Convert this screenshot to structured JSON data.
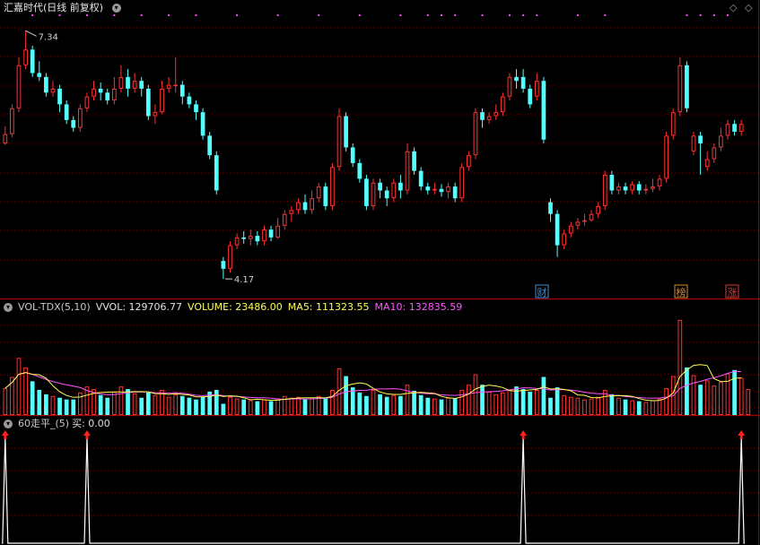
{
  "main": {
    "stock_name": "汇嘉时代",
    "period": "(日线 前复权)",
    "high_label": "7.34",
    "low_label": "4.17",
    "markers": [
      {
        "id": "cai",
        "text": "财",
        "color": "#3a8fd8"
      },
      {
        "id": "bang",
        "text": "榜",
        "color": "#d08a3a"
      },
      {
        "id": "zhang",
        "text": "涨",
        "color": "#d83a3a"
      }
    ]
  },
  "volume": {
    "indicator": "VOL-TDX(5,10)",
    "vvol": "VVOL: 129706.77",
    "volume": "VOLUME: 23486.00",
    "ma5": "MA5: 111323.55",
    "ma10": "MA10: 132835.59"
  },
  "signal": {
    "indicator": "60走平_(5)",
    "buy": "买: 0.00"
  },
  "colors": {
    "up": "#ff3232",
    "down": "#54ffff",
    "ma5": "#ffff55",
    "ma10": "#ff55ff",
    "grid": "#7a0000",
    "separator": "#a00000",
    "signal": "#ffffff",
    "arrow": "#ff2020"
  },
  "chart_data": [
    {
      "type": "candlestick",
      "title": "汇嘉时代 (日线 前复权)",
      "annotations": [
        {
          "label": "7.34",
          "value": 7.34
        },
        {
          "label": "4.17",
          "value": 4.17
        }
      ],
      "candles": [
        [
          5.9,
          6.02,
          6.12,
          5.88
        ],
        [
          6.02,
          6.35,
          6.4,
          5.98
        ],
        [
          6.35,
          6.9,
          7.0,
          6.3
        ],
        [
          6.9,
          7.1,
          7.34,
          6.85
        ],
        [
          7.1,
          6.8,
          7.15,
          6.75
        ],
        [
          6.8,
          6.75,
          6.95,
          6.7
        ],
        [
          6.75,
          6.55,
          6.8,
          6.5
        ],
        [
          6.55,
          6.6,
          6.7,
          6.5
        ],
        [
          6.6,
          6.4,
          6.65,
          6.3
        ],
        [
          6.4,
          6.2,
          6.45,
          6.15
        ],
        [
          6.2,
          6.1,
          6.25,
          6.05
        ],
        [
          6.1,
          6.35,
          6.4,
          6.05
        ],
        [
          6.35,
          6.5,
          6.55,
          6.3
        ],
        [
          6.5,
          6.6,
          6.7,
          6.45
        ],
        [
          6.6,
          6.55,
          6.68,
          6.45
        ],
        [
          6.55,
          6.45,
          6.6,
          6.4
        ],
        [
          6.45,
          6.6,
          6.75,
          6.4
        ],
        [
          6.6,
          6.75,
          6.9,
          6.55
        ],
        [
          6.75,
          6.6,
          6.85,
          6.5
        ],
        [
          6.6,
          6.7,
          6.8,
          6.55
        ],
        [
          6.7,
          6.6,
          6.75,
          6.5
        ],
        [
          6.6,
          6.25,
          6.65,
          6.2
        ],
        [
          6.25,
          6.3,
          6.4,
          6.15
        ],
        [
          6.3,
          6.6,
          6.7,
          6.28
        ],
        [
          6.6,
          6.65,
          6.75,
          6.55
        ],
        [
          6.65,
          6.65,
          7.0,
          6.55
        ],
        [
          6.65,
          6.5,
          6.7,
          6.4
        ],
        [
          6.5,
          6.4,
          6.55,
          6.35
        ],
        [
          6.4,
          6.3,
          6.45,
          6.2
        ],
        [
          6.3,
          6.0,
          6.35,
          5.95
        ],
        [
          6.0,
          5.75,
          6.05,
          5.7
        ],
        [
          5.75,
          5.3,
          5.8,
          5.25
        ],
        [
          4.4,
          4.3,
          4.45,
          4.17
        ],
        [
          4.3,
          4.6,
          4.65,
          4.25
        ],
        [
          4.6,
          4.7,
          4.75,
          4.55
        ],
        [
          4.7,
          4.68,
          4.78,
          4.62
        ],
        [
          4.68,
          4.72,
          4.8,
          4.6
        ],
        [
          4.72,
          4.65,
          4.78,
          4.6
        ],
        [
          4.65,
          4.8,
          4.85,
          4.6
        ],
        [
          4.8,
          4.7,
          4.85,
          4.65
        ],
        [
          4.7,
          4.85,
          4.95,
          4.68
        ],
        [
          4.85,
          5.0,
          5.05,
          4.8
        ],
        [
          5.0,
          5.05,
          5.1,
          4.9
        ],
        [
          5.05,
          5.15,
          5.2,
          5.0
        ],
        [
          5.15,
          5.05,
          5.25,
          5.0
        ],
        [
          5.05,
          5.2,
          5.3,
          5.0
        ],
        [
          5.2,
          5.35,
          5.4,
          5.15
        ],
        [
          5.35,
          5.1,
          5.4,
          5.05
        ],
        [
          5.1,
          5.6,
          5.65,
          5.05
        ],
        [
          5.6,
          6.25,
          6.35,
          5.55
        ],
        [
          6.25,
          5.85,
          6.3,
          5.8
        ],
        [
          5.85,
          5.65,
          5.9,
          5.6
        ],
        [
          5.65,
          5.45,
          5.7,
          5.4
        ],
        [
          5.45,
          5.1,
          5.5,
          5.05
        ],
        [
          5.1,
          5.4,
          5.45,
          5.05
        ],
        [
          5.4,
          5.3,
          5.45,
          5.2
        ],
        [
          5.3,
          5.2,
          5.35,
          5.1
        ],
        [
          5.2,
          5.4,
          5.45,
          5.15
        ],
        [
          5.4,
          5.3,
          5.5,
          5.2
        ],
        [
          5.3,
          5.8,
          5.9,
          5.25
        ],
        [
          5.8,
          5.55,
          5.85,
          5.5
        ],
        [
          5.55,
          5.35,
          5.6,
          5.3
        ],
        [
          5.35,
          5.3,
          5.4,
          5.25
        ],
        [
          5.3,
          5.32,
          5.4,
          5.25
        ],
        [
          5.32,
          5.28,
          5.38,
          5.22
        ],
        [
          5.28,
          5.35,
          5.4,
          5.2
        ],
        [
          5.35,
          5.2,
          5.4,
          5.15
        ],
        [
          5.2,
          5.6,
          5.65,
          5.15
        ],
        [
          5.6,
          5.75,
          5.8,
          5.55
        ],
        [
          5.75,
          6.3,
          6.35,
          5.7
        ],
        [
          6.3,
          6.2,
          6.35,
          6.1
        ],
        [
          6.2,
          6.25,
          6.3,
          6.15
        ],
        [
          6.25,
          6.3,
          6.4,
          6.2
        ],
        [
          6.3,
          6.5,
          6.55,
          6.25
        ],
        [
          6.5,
          6.75,
          6.8,
          6.45
        ],
        [
          6.75,
          6.7,
          6.85,
          6.6
        ],
        [
          6.75,
          6.6,
          6.85,
          6.55
        ],
        [
          6.6,
          6.4,
          6.65,
          6.35
        ],
        [
          6.5,
          6.7,
          6.8,
          6.45
        ],
        [
          6.7,
          5.95,
          6.75,
          5.9
        ],
        [
          5.15,
          5.0,
          5.2,
          4.9
        ],
        [
          5.0,
          4.6,
          5.05,
          4.45
        ],
        [
          4.6,
          4.75,
          4.8,
          4.55
        ],
        [
          4.75,
          4.85,
          4.9,
          4.7
        ],
        [
          4.85,
          4.9,
          4.95,
          4.8
        ],
        [
          4.9,
          4.92,
          5.0,
          4.85
        ],
        [
          4.92,
          5.0,
          5.05,
          4.9
        ],
        [
          5.0,
          5.1,
          5.15,
          4.95
        ],
        [
          5.1,
          5.5,
          5.55,
          5.05
        ],
        [
          5.5,
          5.3,
          5.55,
          5.25
        ],
        [
          5.3,
          5.35,
          5.4,
          5.25
        ],
        [
          5.35,
          5.3,
          5.4,
          5.25
        ],
        [
          5.3,
          5.38,
          5.42,
          5.25
        ],
        [
          5.38,
          5.3,
          5.42,
          5.25
        ],
        [
          5.3,
          5.32,
          5.38,
          5.25
        ],
        [
          5.32,
          5.35,
          5.45,
          5.28
        ],
        [
          5.35,
          5.45,
          5.5,
          5.3
        ],
        [
          5.45,
          6.0,
          6.05,
          5.4
        ],
        [
          6.0,
          6.3,
          6.35,
          5.95
        ],
        [
          6.3,
          6.9,
          7.0,
          6.25
        ],
        [
          6.9,
          6.35,
          6.95,
          6.3
        ],
        [
          5.8,
          6.0,
          6.05,
          5.75
        ],
        [
          6.0,
          5.9,
          6.05,
          5.5
        ],
        [
          5.6,
          5.7,
          5.8,
          5.55
        ],
        [
          5.7,
          5.85,
          5.9,
          5.65
        ],
        [
          5.85,
          6.0,
          6.1,
          5.8
        ],
        [
          6.0,
          6.15,
          6.2,
          5.95
        ],
        [
          6.15,
          6.05,
          6.2,
          6.0
        ],
        [
          6.05,
          6.15,
          6.2,
          6.0
        ]
      ]
    },
    {
      "type": "bar",
      "title": "VOL-TDX(5,10)",
      "legend": [
        "VVOL: 129706.77",
        "VOLUME: 23486.00",
        "MA5: 111323.55",
        "MA10: 132835.59"
      ],
      "values": [
        62,
        88,
        132,
        110,
        78,
        58,
        48,
        44,
        40,
        36,
        36,
        52,
        66,
        60,
        46,
        40,
        54,
        66,
        60,
        50,
        40,
        52,
        46,
        58,
        42,
        48,
        44,
        40,
        36,
        42,
        54,
        58,
        26,
        42,
        38,
        36,
        34,
        32,
        36,
        32,
        38,
        44,
        40,
        42,
        36,
        38,
        44,
        38,
        58,
        108,
        90,
        64,
        52,
        44,
        58,
        48,
        42,
        46,
        44,
        70,
        56,
        46,
        40,
        38,
        36,
        40,
        38,
        58,
        70,
        94,
        70,
        54,
        48,
        52,
        58,
        66,
        60,
        54,
        58,
        88,
        40,
        64,
        46,
        42,
        40,
        36,
        38,
        42,
        58,
        48,
        40,
        36,
        34,
        32,
        30,
        34,
        38,
        62,
        90,
        220,
        110,
        92,
        70,
        80,
        68,
        76,
        96,
        104,
        86,
        60
      ],
      "up": [
        1,
        1,
        1,
        1,
        0,
        0,
        0,
        1,
        0,
        0,
        0,
        1,
        1,
        1,
        0,
        0,
        1,
        1,
        0,
        1,
        0,
        0,
        1,
        1,
        1,
        1,
        0,
        0,
        0,
        0,
        0,
        0,
        0,
        1,
        1,
        0,
        1,
        0,
        1,
        0,
        1,
        1,
        1,
        1,
        0,
        1,
        1,
        0,
        1,
        1,
        0,
        0,
        0,
        0,
        1,
        0,
        0,
        1,
        0,
        1,
        0,
        0,
        0,
        1,
        0,
        1,
        0,
        1,
        1,
        1,
        0,
        1,
        1,
        1,
        1,
        0,
        0,
        0,
        1,
        0,
        0,
        0,
        1,
        1,
        1,
        1,
        1,
        1,
        1,
        0,
        1,
        0,
        1,
        0,
        1,
        1,
        1,
        1,
        1,
        1,
        0,
        1,
        0,
        1,
        1,
        1,
        1,
        0,
        1,
        1
      ],
      "series": [
        {
          "name": "MA5"
        },
        {
          "name": "MA10"
        }
      ]
    },
    {
      "type": "line",
      "title": "60走平_(5)",
      "legend": [
        "买: 0.00"
      ],
      "signal_indices": [
        0,
        12,
        76,
        108
      ]
    }
  ]
}
